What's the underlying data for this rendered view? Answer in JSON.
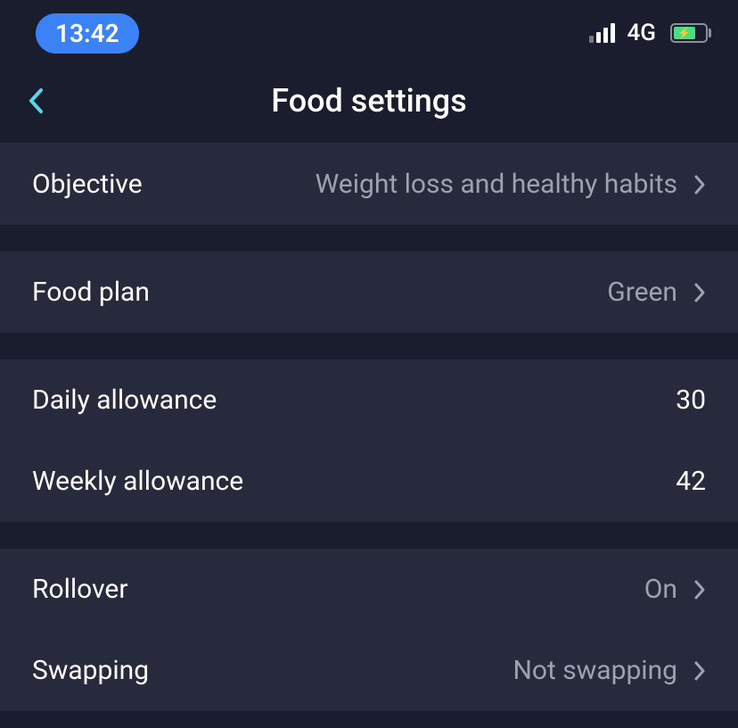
{
  "status": {
    "time": "13:42",
    "network": "4G"
  },
  "header": {
    "title": "Food settings"
  },
  "settings": {
    "objective": {
      "label": "Objective",
      "value": "Weight loss and healthy habits"
    },
    "food_plan": {
      "label": "Food plan",
      "value": "Green"
    },
    "daily_allowance": {
      "label": "Daily allowance",
      "value": "30"
    },
    "weekly_allowance": {
      "label": "Weekly allowance",
      "value": "42"
    },
    "rollover": {
      "label": "Rollover",
      "value": "On"
    },
    "swapping": {
      "label": "Swapping",
      "value": "Not swapping"
    }
  }
}
